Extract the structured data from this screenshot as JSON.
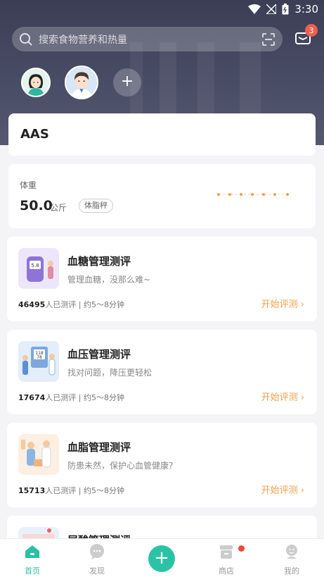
{
  "status_bar": {
    "time": "3:30"
  },
  "search": {
    "placeholder": "搜索食物营养和热量"
  },
  "messages": {
    "badge_count": "3"
  },
  "family": {
    "add_label": "+"
  },
  "profile": {
    "name": "AAS"
  },
  "weight": {
    "label": "体重",
    "value": "50.0",
    "unit": "公斤",
    "device_tag": "体脂秤"
  },
  "tests": [
    {
      "title": "血糖管理测评",
      "subtitle": "管理血糖，没那么难~",
      "count": "46495",
      "count_suffix": "人已测评",
      "duration": "约5～8分钟",
      "cta": "开始评测"
    },
    {
      "title": "血压管理测评",
      "subtitle": "找对问题，降压更轻松",
      "count": "17674",
      "count_suffix": "人已测评",
      "duration": "约5～8分钟",
      "cta": "开始评测"
    },
    {
      "title": "血脂管理测评",
      "subtitle": "防患未然，保护心血管健康?",
      "count": "15713",
      "count_suffix": "人已测评",
      "duration": "约5～8分钟",
      "cta": "开始评测"
    },
    {
      "title": "尿酸管理测评"
    }
  ],
  "tabbar": {
    "home": "首页",
    "discover": "发现",
    "add": "+",
    "shop": "商店",
    "mine": "我的"
  },
  "colors": {
    "accent": "#2bc3a5",
    "cta": "#f0a04b",
    "hero": "#3b3e55",
    "badge": "#f0604d"
  }
}
